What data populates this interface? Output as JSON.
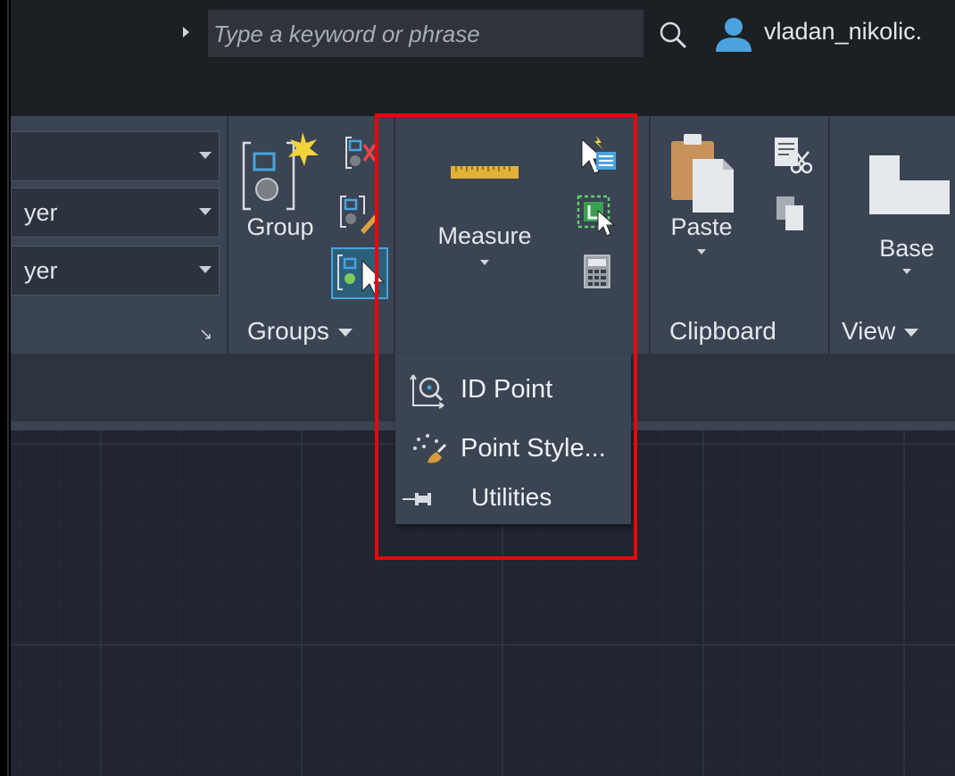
{
  "search": {
    "placeholder": "Type a keyword or phrase"
  },
  "user": {
    "name": "vladan_nikolic."
  },
  "layers": {
    "combos": [
      {
        "value": ""
      },
      {
        "value": "yer"
      },
      {
        "value": "yer"
      }
    ]
  },
  "groups": {
    "group_label": "Group",
    "panel_title": "Groups"
  },
  "utilities": {
    "measure_label": "Measure",
    "flyout_items": [
      {
        "label": "ID Point"
      },
      {
        "label": "Point Style..."
      }
    ],
    "panel_title": "Utilities"
  },
  "clipboard": {
    "paste_label": "Paste",
    "panel_title": "Clipboard"
  },
  "view": {
    "base_label": "Base",
    "panel_title": "View"
  },
  "colors": {
    "highlight": "#e8060c",
    "ribbon": "#3b4453",
    "ruler": "#e0b23a",
    "accent_blue": "#4aa3df"
  }
}
